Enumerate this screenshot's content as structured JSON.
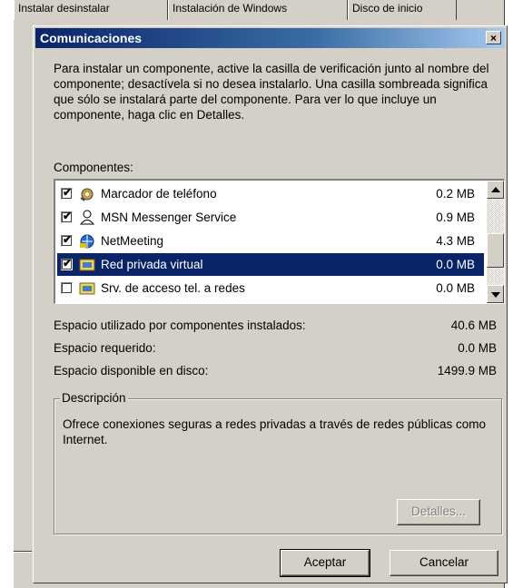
{
  "background": {
    "tabs": [
      "Instalar desinstalar",
      "Instalación de Windows",
      "Disco de inicio"
    ]
  },
  "dialog": {
    "title": "Comunicaciones",
    "close_label": "×",
    "instructions": "Para instalar un componente, active la casilla de verificación junto al nombre del componente; desactívela si no desea instalarlo. Una casilla sombreada significa que sólo se instalará parte del componente. Para ver lo que incluye un componente, haga clic en Detalles.",
    "components_label": "Componentes:",
    "components": [
      {
        "name": "Marcador de teléfono",
        "size": "0.2 MB",
        "checked": true,
        "selected": false,
        "icon": "phone-dialer-icon"
      },
      {
        "name": "MSN Messenger Service",
        "size": "0.9 MB",
        "checked": true,
        "selected": false,
        "icon": "messenger-user-icon"
      },
      {
        "name": "NetMeeting",
        "size": "4.3 MB",
        "checked": true,
        "selected": false,
        "icon": "netmeeting-icon"
      },
      {
        "name": "Red privada virtual",
        "size": "0.0 MB",
        "checked": true,
        "selected": true,
        "icon": "network-folder-icon"
      },
      {
        "name": "Srv. de acceso tel. a redes",
        "size": "0.0 MB",
        "checked": false,
        "selected": false,
        "icon": "network-folder-icon"
      }
    ],
    "space": {
      "used_label": "Espacio utilizado por componentes instalados:",
      "used_value": "40.6 MB",
      "required_label": "Espacio requerido:",
      "required_value": "0.0 MB",
      "available_label": "Espacio disponible en disco:",
      "available_value": "1499.9 MB"
    },
    "description": {
      "title": "Descripción",
      "text": "Ofrece conexiones seguras a redes privadas a través de redes públicas como Internet."
    },
    "buttons": {
      "details": "Detalles...",
      "accept": "Aceptar",
      "cancel": "Cancelar"
    }
  },
  "colors": {
    "face": "#d4d0c8",
    "titlebar": "#0a246a",
    "selection": "#0a246a"
  }
}
